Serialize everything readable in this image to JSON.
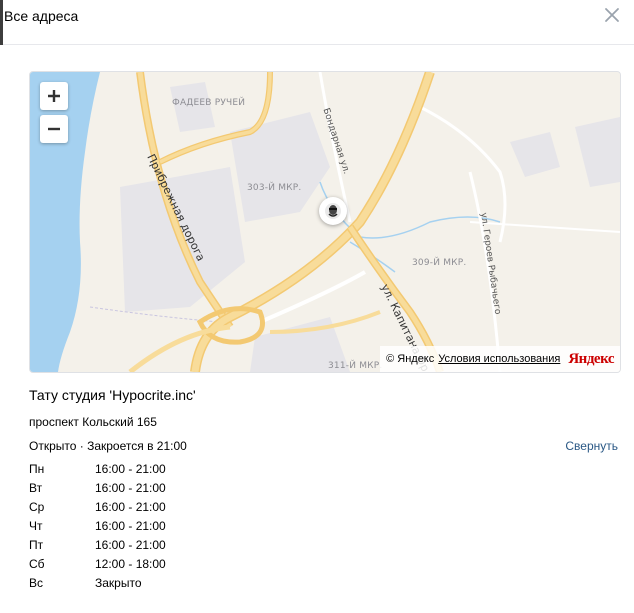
{
  "header": {
    "title": "Все адреса",
    "close_icon": "close-icon"
  },
  "map": {
    "zoom_in_icon": "plus-icon",
    "zoom_out_icon": "minus-icon",
    "districts": [
      "ФАДЕЕВ РУЧЕЙ",
      "303-Й МКР.",
      "309-Й МКР.",
      "311-Й МКР."
    ],
    "streets": [
      "Прибрежная дорога",
      "Бондарная ул.",
      "ул. Героев Рыбачьего",
      "ул. Капитана Ор"
    ],
    "marker_icon": "place-avatar-icon",
    "attribution": {
      "copyright": "© Яндекс",
      "terms": "Условия использования",
      "logo": "Яндекс"
    },
    "colors": {
      "water": "#a5d1f0",
      "land": "#f4f1ea",
      "highway": "#f7d78b",
      "block": "#e6e5e9"
    }
  },
  "place": {
    "name": "Тату студия 'Hypocrite.inc'",
    "address": "проспект Кольский 165",
    "status": "Открыто · Закроется в 21:00",
    "collapse_label": "Свернуть",
    "hours": [
      {
        "day": "Пн",
        "time": "16:00 - 21:00"
      },
      {
        "day": "Вт",
        "time": "16:00 - 21:00"
      },
      {
        "day": "Ср",
        "time": "16:00 - 21:00"
      },
      {
        "day": "Чт",
        "time": "16:00 - 21:00"
      },
      {
        "day": "Пт",
        "time": "16:00 - 21:00"
      },
      {
        "day": "Сб",
        "time": "12:00 - 18:00"
      },
      {
        "day": "Вс",
        "time": "Закрыто"
      }
    ]
  },
  "colors": {
    "link": "#2a5885",
    "border": "#e7e8ec"
  }
}
